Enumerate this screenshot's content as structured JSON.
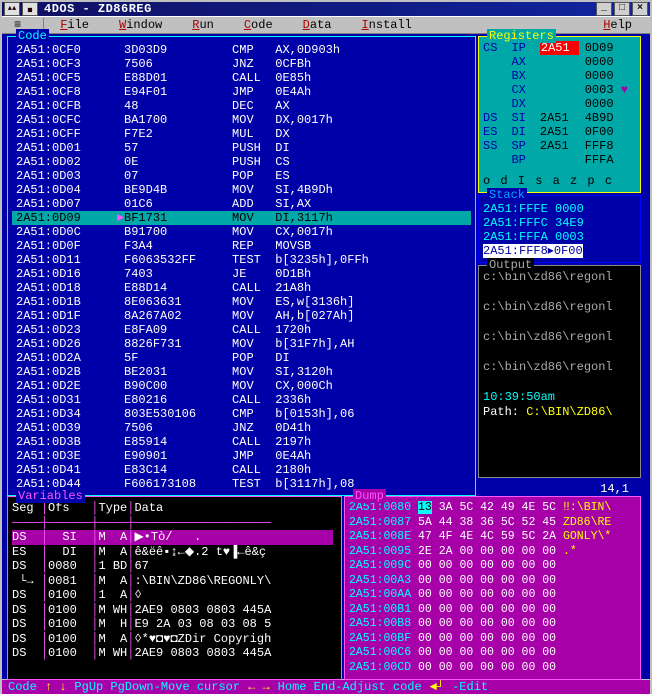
{
  "window": {
    "title": "4DOS - ZD86REG"
  },
  "menu": {
    "sysmenu": "≡",
    "items": [
      "File",
      "Window",
      "Run",
      "Code",
      "Data",
      "Install",
      "Help"
    ],
    "hotkeys": [
      "F",
      "W",
      "R",
      "C",
      "D",
      "I",
      "H"
    ]
  },
  "code": {
    "title": "Code",
    "lines": [
      {
        "a": "2A51:0CF0",
        "b": "3D03D9",
        "m": "CMP",
        "o": "AX,0D903h"
      },
      {
        "a": "2A51:0CF3",
        "b": "7506",
        "m": "JNZ",
        "o": "0CFBh"
      },
      {
        "a": "2A51:0CF5",
        "b": "E88D01",
        "m": "CALL",
        "o": "0E85h"
      },
      {
        "a": "2A51:0CF8",
        "b": "E94F01",
        "m": "JMP",
        "o": "0E4Ah"
      },
      {
        "a": "2A51:0CFB",
        "b": "48",
        "m": "DEC",
        "o": "AX"
      },
      {
        "a": "2A51:0CFC",
        "b": "BA1700",
        "m": "MOV",
        "o": "DX,0017h"
      },
      {
        "a": "2A51:0CFF",
        "b": "F7E2",
        "m": "MUL",
        "o": "DX"
      },
      {
        "a": "2A51:0D01",
        "b": "57",
        "m": "PUSH",
        "o": "DI"
      },
      {
        "a": "2A51:0D02",
        "b": "0E",
        "m": "PUSH",
        "o": "CS"
      },
      {
        "a": "2A51:0D03",
        "b": "07",
        "m": "POP",
        "o": "ES"
      },
      {
        "a": "2A51:0D04",
        "b": "BE9D4B",
        "m": "MOV",
        "o": "SI,4B9Dh"
      },
      {
        "a": "2A51:0D07",
        "b": "01C6",
        "m": "ADD",
        "o": "SI,AX"
      },
      {
        "a": "2A51:0D09",
        "b": "BF1731",
        "m": "MOV",
        "o": "DI,3117h",
        "hi": true
      },
      {
        "a": "2A51:0D0C",
        "b": "B91700",
        "m": "MOV",
        "o": "CX,0017h"
      },
      {
        "a": "2A51:0D0F",
        "b": "F3A4",
        "m": "REP",
        "o": "MOVSB"
      },
      {
        "a": "2A51:0D11",
        "b": "F6063532FF",
        "m": "TEST",
        "o": "b[3235h],0FFh"
      },
      {
        "a": "2A51:0D16",
        "b": "7403",
        "m": "JE",
        "o": "0D1Bh"
      },
      {
        "a": "2A51:0D18",
        "b": "E88D14",
        "m": "CALL",
        "o": "21A8h"
      },
      {
        "a": "2A51:0D1B",
        "b": "8E063631",
        "m": "MOV",
        "o": "ES,w[3136h]"
      },
      {
        "a": "2A51:0D1F",
        "b": "8A267A02",
        "m": "MOV",
        "o": "AH,b[027Ah]"
      },
      {
        "a": "2A51:0D23",
        "b": "E8FA09",
        "m": "CALL",
        "o": "1720h"
      },
      {
        "a": "2A51:0D26",
        "b": "8826F731",
        "m": "MOV",
        "o": "b[31F7h],AH"
      },
      {
        "a": "2A51:0D2A",
        "b": "5F",
        "m": "POP",
        "o": "DI"
      },
      {
        "a": "2A51:0D2B",
        "b": "BE2031",
        "m": "MOV",
        "o": "SI,3120h"
      },
      {
        "a": "2A51:0D2E",
        "b": "B90C00",
        "m": "MOV",
        "o": "CX,000Ch"
      },
      {
        "a": "2A51:0D31",
        "b": "E80216",
        "m": "CALL",
        "o": "2336h"
      },
      {
        "a": "2A51:0D34",
        "b": "803E530106",
        "m": "CMP",
        "o": "b[0153h],06"
      },
      {
        "a": "2A51:0D39",
        "b": "7506",
        "m": "JNZ",
        "o": "0D41h"
      },
      {
        "a": "2A51:0D3B",
        "b": "E85914",
        "m": "CALL",
        "o": "2197h"
      },
      {
        "a": "2A51:0D3E",
        "b": "E90901",
        "m": "JMP",
        "o": "0E4Ah"
      },
      {
        "a": "2A51:0D41",
        "b": "E83C14",
        "m": "CALL",
        "o": "2180h"
      },
      {
        "a": "2A51:0D44",
        "b": "F606173108",
        "m": "TEST",
        "o": "b[3117h],08"
      }
    ]
  },
  "registers": {
    "title": "Registers",
    "rows": [
      [
        "CS",
        "IP",
        "2A51",
        "0D09",
        true
      ],
      [
        "",
        "AX",
        "",
        "0000"
      ],
      [
        "",
        "BX",
        "",
        "0000"
      ],
      [
        "",
        "CX",
        "",
        "0003"
      ],
      [
        "",
        "DX",
        "",
        "0000"
      ],
      [
        "DS",
        "SI",
        "2A51",
        "4B9D"
      ],
      [
        "ES",
        "DI",
        "2A51",
        "0F00"
      ],
      [
        "SS",
        "SP",
        "2A51",
        "FFF8"
      ],
      [
        "",
        "BP",
        "",
        "FFFA"
      ]
    ],
    "flags": "o d I s a z p c"
  },
  "stack": {
    "title": "Stack",
    "lines": [
      "2A51:FFFE 0000",
      "2A51:FFFC 34E9",
      "2A51:FFFA 0003",
      "2A51:FFF8▸0F00"
    ]
  },
  "output": {
    "title": "Output",
    "lines": [
      "c:\\bin\\zd86\\regonl",
      "",
      "c:\\bin\\zd86\\regonl",
      "",
      "c:\\bin\\zd86\\regonl",
      "",
      "c:\\bin\\zd86\\regonl",
      ""
    ],
    "time": "10:39:50am",
    "pathlabel": "Path:",
    "path": "C:\\BIN\\ZD86\\"
  },
  "position": "14,1",
  "variables": {
    "title": "Variables",
    "header": "Seg |Ofs   |Type|Data",
    "rows": [
      {
        "seg": "DS",
        "ofs": "  SI",
        "typ": "M  A",
        "data": "▶•Tò/   .",
        "hi": true
      },
      {
        "seg": "ES",
        "ofs": "  DI",
        "typ": "M  A",
        "data": "ê&ëê▪↨←◆.2 t♥▐←ê&ç"
      },
      {
        "seg": "DS",
        "ofs": "0080",
        "typ": "1 BD",
        "data": "67"
      },
      {
        "seg": " └→",
        "ofs": "0081",
        "typ": "M  A",
        "data": ":\\BIN\\ZD86\\REGONLY\\"
      },
      {
        "seg": "DS",
        "ofs": "0100",
        "typ": "1  A",
        "data": "◊"
      },
      {
        "seg": "DS",
        "ofs": "0100",
        "typ": "M WH",
        "data": "2AE9 0803 0803 445A"
      },
      {
        "seg": "DS",
        "ofs": "0100",
        "typ": "M  H",
        "data": "E9 2A 03 08 03 08 5"
      },
      {
        "seg": "DS",
        "ofs": "0100",
        "typ": "M  A",
        "data": "◊*♥◘♥◘ZDir Copyrigh"
      },
      {
        "seg": "DS",
        "ofs": "0100",
        "typ": "M WH",
        "data": "2AE9 0803 0803 445A"
      }
    ]
  },
  "dump": {
    "title": "Dump",
    "lines": [
      {
        "addr": "2A51:0080",
        "hex": "13 3A 5C 42 49 4E 5C",
        "asc": "‼:\\BIN\\",
        "cur": true
      },
      {
        "addr": "2A51:0087",
        "hex": "5A 44 38 36 5C 52 45",
        "asc": "ZD86\\RE"
      },
      {
        "addr": "2A51:008E",
        "hex": "47 4F 4E 4C 59 5C 2A",
        "asc": "GONLY\\*"
      },
      {
        "addr": "2A51:0095",
        "hex": "2E 2A 00 00 00 00 00",
        "asc": ".*"
      },
      {
        "addr": "2A51:009C",
        "hex": "00 00 00 00 00 00 00",
        "asc": ""
      },
      {
        "addr": "2A51:00A3",
        "hex": "00 00 00 00 00 00 00",
        "asc": ""
      },
      {
        "addr": "2A51:00AA",
        "hex": "00 00 00 00 00 00 00",
        "asc": ""
      },
      {
        "addr": "2A51:00B1",
        "hex": "00 00 00 00 00 00 00",
        "asc": ""
      },
      {
        "addr": "2A51:00B8",
        "hex": "00 00 00 00 00 00 00",
        "asc": ""
      },
      {
        "addr": "2A51:00BF",
        "hex": "00 00 00 00 00 00 00",
        "asc": ""
      },
      {
        "addr": "2A51:00C6",
        "hex": "00 00 00 00 00 00 00",
        "asc": ""
      },
      {
        "addr": "2A51:00CD",
        "hex": "00 00 00 00 00 00 00",
        "asc": ""
      }
    ]
  },
  "statusbar": {
    "label": "Code",
    "hint1": "PgUp PgDown-Move cursor",
    "hint2": "Home End-Adjust code",
    "hint3": "-Edit"
  }
}
